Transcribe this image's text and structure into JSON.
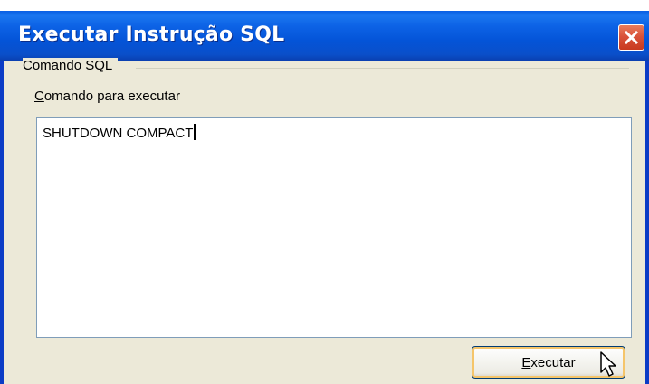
{
  "window": {
    "title": "Executar Instrução SQL",
    "close_icon": "close-icon",
    "titlebar_color": "#0454d8",
    "close_color": "#d9533a"
  },
  "group": {
    "label": "Comando SQL"
  },
  "command_field": {
    "label_first": "C",
    "label_rest": "omando para executar",
    "value": "SHUTDOWN COMPACT"
  },
  "execute_button": {
    "label_first": "E",
    "label_rest": "xecutar"
  },
  "pointer": {
    "icon": "mouse-pointer-icon"
  }
}
